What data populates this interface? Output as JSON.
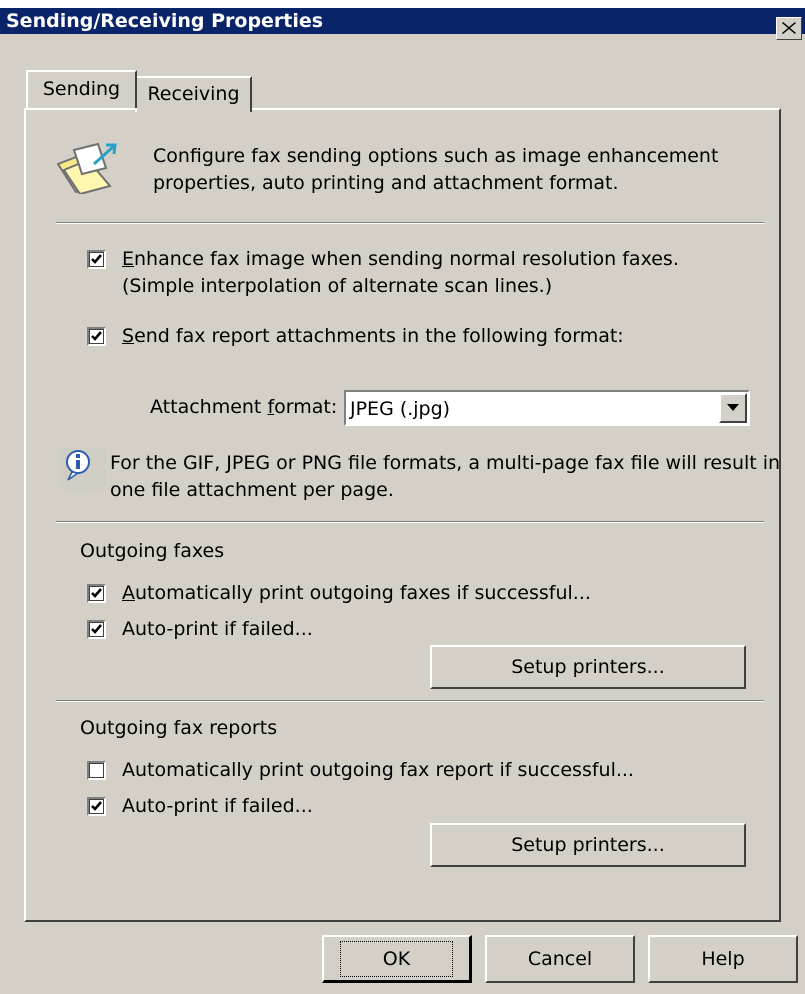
{
  "window": {
    "title": "Sending/Receiving Properties",
    "close_glyph": "close-icon"
  },
  "tabs": [
    {
      "label": "Sending",
      "selected": true
    },
    {
      "label": "Receiving",
      "selected": false
    }
  ],
  "intro": {
    "icon": "fax-folder-icon",
    "line1": "Configure fax sending options such as image enhancement",
    "line2": "properties, auto printing and attachment format."
  },
  "enhance": {
    "checked": true,
    "mnemonic": "E",
    "label_rest": "nhance fax image when sending normal resolution faxes.",
    "sublabel": "(Simple interpolation of alternate scan lines.)"
  },
  "send_report": {
    "checked": true,
    "mnemonic": "S",
    "label_rest": "end fax report attachments in the following format:"
  },
  "attachment": {
    "label_pre": "Attachment ",
    "mnemonic": "f",
    "label_post": "ormat:",
    "value": "JPEG (.jpg)"
  },
  "info": {
    "icon": "info-icon",
    "line1": "For the GIF, JPEG or PNG file formats, a multi-page fax file will result in",
    "line2": "one file attachment per page."
  },
  "outgoing_faxes": {
    "heading": "Outgoing faxes",
    "auto_print": {
      "checked": true,
      "mnemonic": "A",
      "label_rest": "utomatically print outgoing faxes if successful..."
    },
    "auto_print_failed": {
      "checked": true,
      "label": "Auto-print if failed..."
    },
    "setup_label": "Setup printers..."
  },
  "outgoing_reports": {
    "heading": "Outgoing fax reports",
    "auto_print": {
      "checked": false,
      "label": "Automatically print outgoing fax report if successful..."
    },
    "auto_print_failed": {
      "checked": true,
      "label": "Auto-print if failed..."
    },
    "setup_label": "Setup printers..."
  },
  "buttons": {
    "ok": "OK",
    "cancel": "Cancel",
    "help": "Help"
  },
  "colors": {
    "titlebar": "#0a246a",
    "face": "#d4d0c8",
    "shadow": "#808080",
    "highlight": "#ffffff"
  }
}
